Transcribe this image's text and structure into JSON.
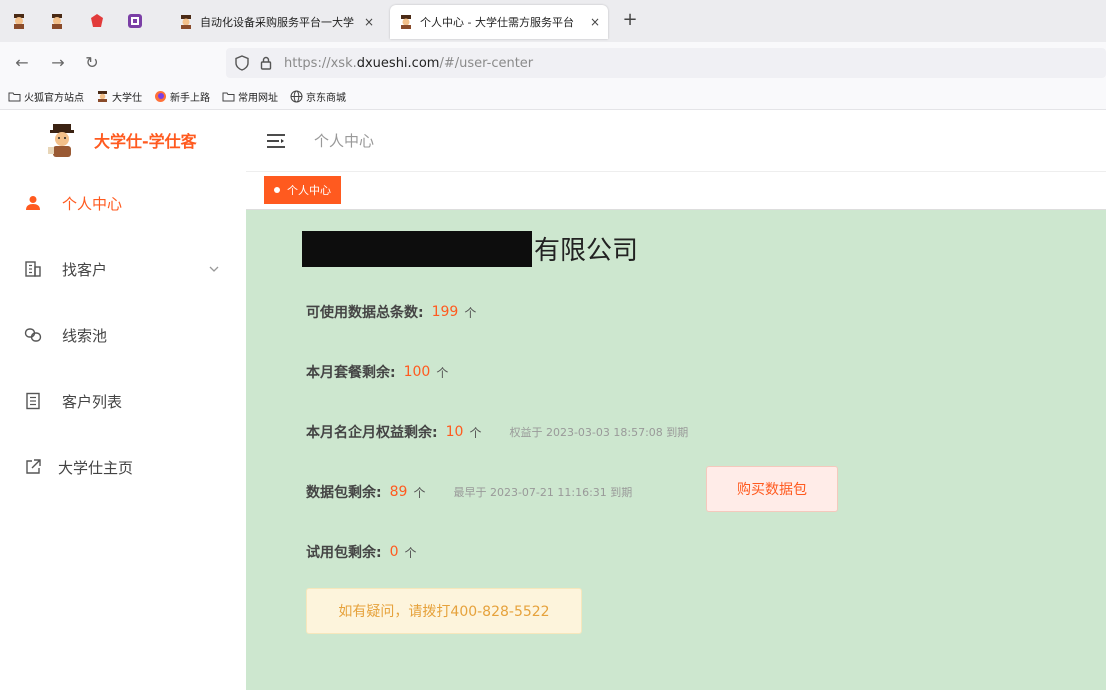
{
  "browser": {
    "tabs": [
      {
        "label": "自动化设备采购服务平台一大学",
        "close": "×"
      },
      {
        "label": "个人中心 - 大学仕需方服务平台",
        "close": "×"
      }
    ],
    "new_tab": "+",
    "url_prefix": "https://xsk.",
    "url_domain": "dxueshi.com",
    "url_path": "/#/user-center",
    "nav": {
      "back": "←",
      "forward": "→",
      "reload": "↻"
    },
    "bookmarks": [
      "火狐官方站点",
      "大学仕",
      "新手上路",
      "常用网址",
      "京东商城"
    ]
  },
  "sidebar": {
    "brand": "大学仕-学仕客",
    "items": [
      {
        "label": "个人中心",
        "icon": "user-icon",
        "active": true
      },
      {
        "label": "找客户",
        "icon": "building-icon",
        "expandable": true
      },
      {
        "label": "线索池",
        "icon": "link-icon"
      },
      {
        "label": "客户列表",
        "icon": "list-icon"
      },
      {
        "label": "大学仕主页",
        "icon": "external-link-icon"
      }
    ]
  },
  "header": {
    "breadcrumb": "个人中心"
  },
  "tags": {
    "active": "个人中心"
  },
  "profile": {
    "company_suffix": "有限公司",
    "total": {
      "label": "可使用数据总条数:",
      "value": "199",
      "unit": "个"
    },
    "monthly_package": {
      "label": "本月套餐剩余:",
      "value": "100",
      "unit": "个"
    },
    "monthly_rights": {
      "label": "本月名企月权益剩余:",
      "value": "10",
      "unit": "个",
      "note": "权益于 2023-03-03 18:57:08 到期"
    },
    "data_pack": {
      "label": "数据包剩余:",
      "value": "89",
      "unit": "个",
      "note": "最早于 2023-07-21 11:16:31 到期"
    },
    "trial": {
      "label": "试用包剩余:",
      "value": "0",
      "unit": "个"
    },
    "buy_button": "购买数据包",
    "notice": "如有疑问，请拨打400-828-5522"
  },
  "colors": {
    "accent": "#ff5a1f",
    "content_bg": "#cde7cf",
    "notice": "#e6a23c"
  }
}
